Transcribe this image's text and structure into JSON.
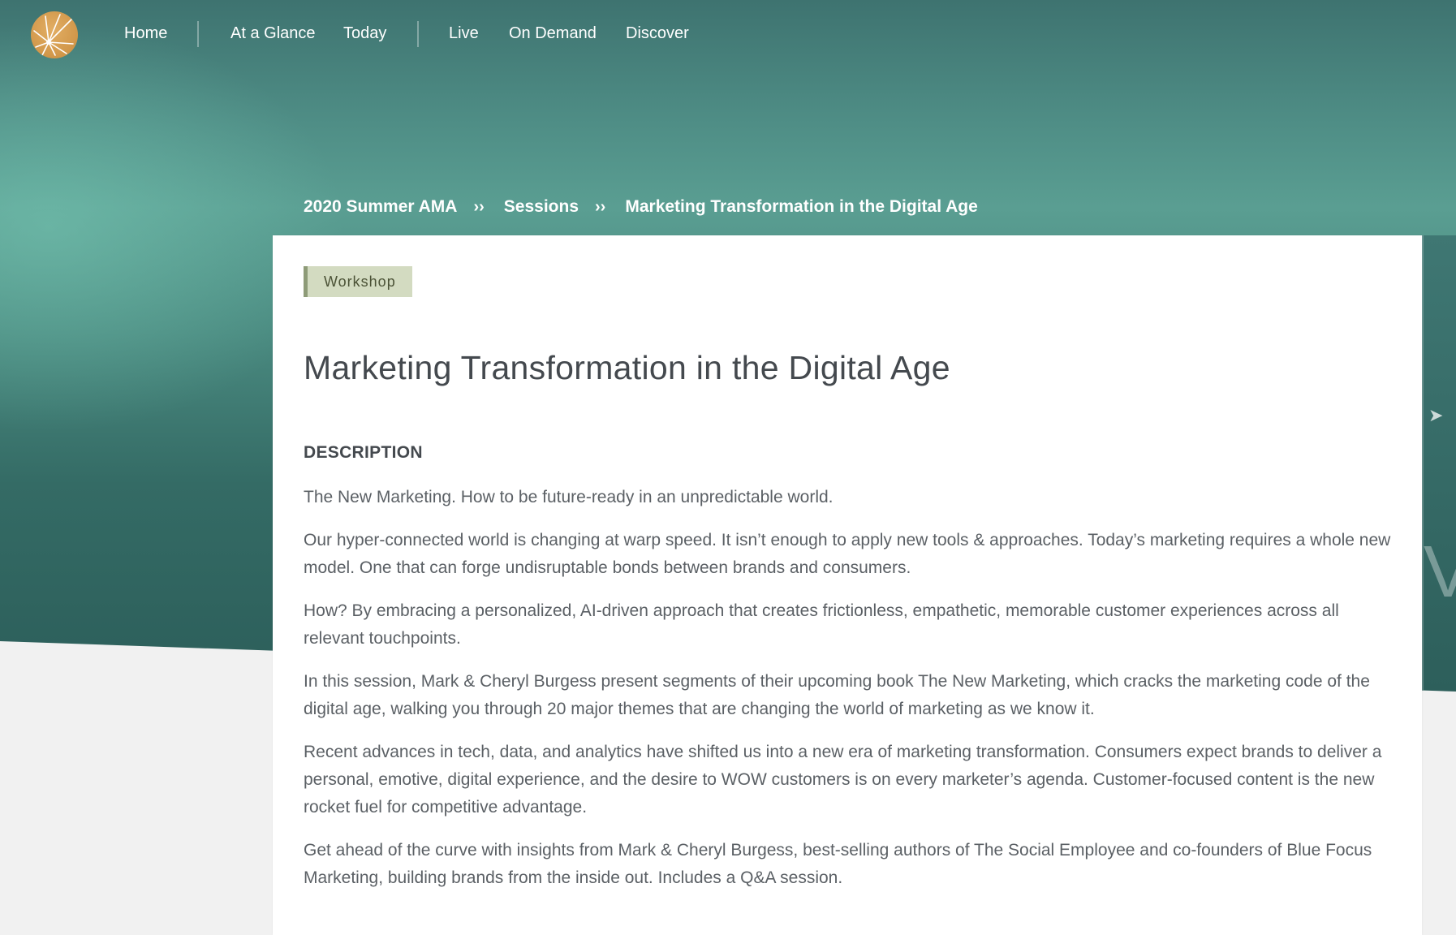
{
  "nav": {
    "items": [
      {
        "label": "Home"
      },
      {
        "label": "At a Glance"
      },
      {
        "label": "Today"
      },
      {
        "label": "Live"
      },
      {
        "label": "On Demand"
      },
      {
        "label": "Discover"
      }
    ]
  },
  "breadcrumb": {
    "items": [
      "2020 Summer AMA",
      "Sessions",
      "Marketing Transformation in the Digital Age"
    ],
    "separator": "››"
  },
  "session": {
    "tag": "Workshop",
    "title": "Marketing Transformation in the Digital Age",
    "description_label": "DESCRIPTION",
    "paragraphs": [
      "The New Marketing. How to be future-ready in an unpredictable world.",
      "Our hyper-connected world is changing at warp speed. It isn’t enough to apply new tools & approaches. Today’s marketing requires a whole new model. One that can forge undisruptable bonds between brands and consumers.",
      "How? By embracing a personalized, AI-driven approach that creates frictionless, empathetic, memorable customer experiences across all relevant touchpoints.",
      "In this session, Mark & Cheryl Burgess present segments of their upcoming book The New Marketing, which cracks the marketing code of the digital age, walking you through 20 major themes that are changing the world of marketing as we know it.",
      "Recent advances in tech, data, and analytics have shifted us into a new era of marketing transformation. Consumers expect brands to deliver a personal, emotive, digital experience, and the desire to WOW customers is on every marketer’s agenda. Customer-focused content is the new rocket fuel for competitive advantage.",
      "Get ahead of the curve with insights from Mark & Cheryl Burgess, best-selling authors of The Social Employee and co-founders of Blue Focus Marketing, building brands from the inside out. Includes a Q&A session."
    ]
  },
  "colors": {
    "hero": "#4f8e86",
    "tag_bg": "#d3dbc1",
    "tag_accent": "#8e9b78",
    "logo": "#d69a4c"
  },
  "icons": {
    "logo": "starburst-logo-icon",
    "breadcrumb_separator": "double-chevron-right-icon"
  }
}
